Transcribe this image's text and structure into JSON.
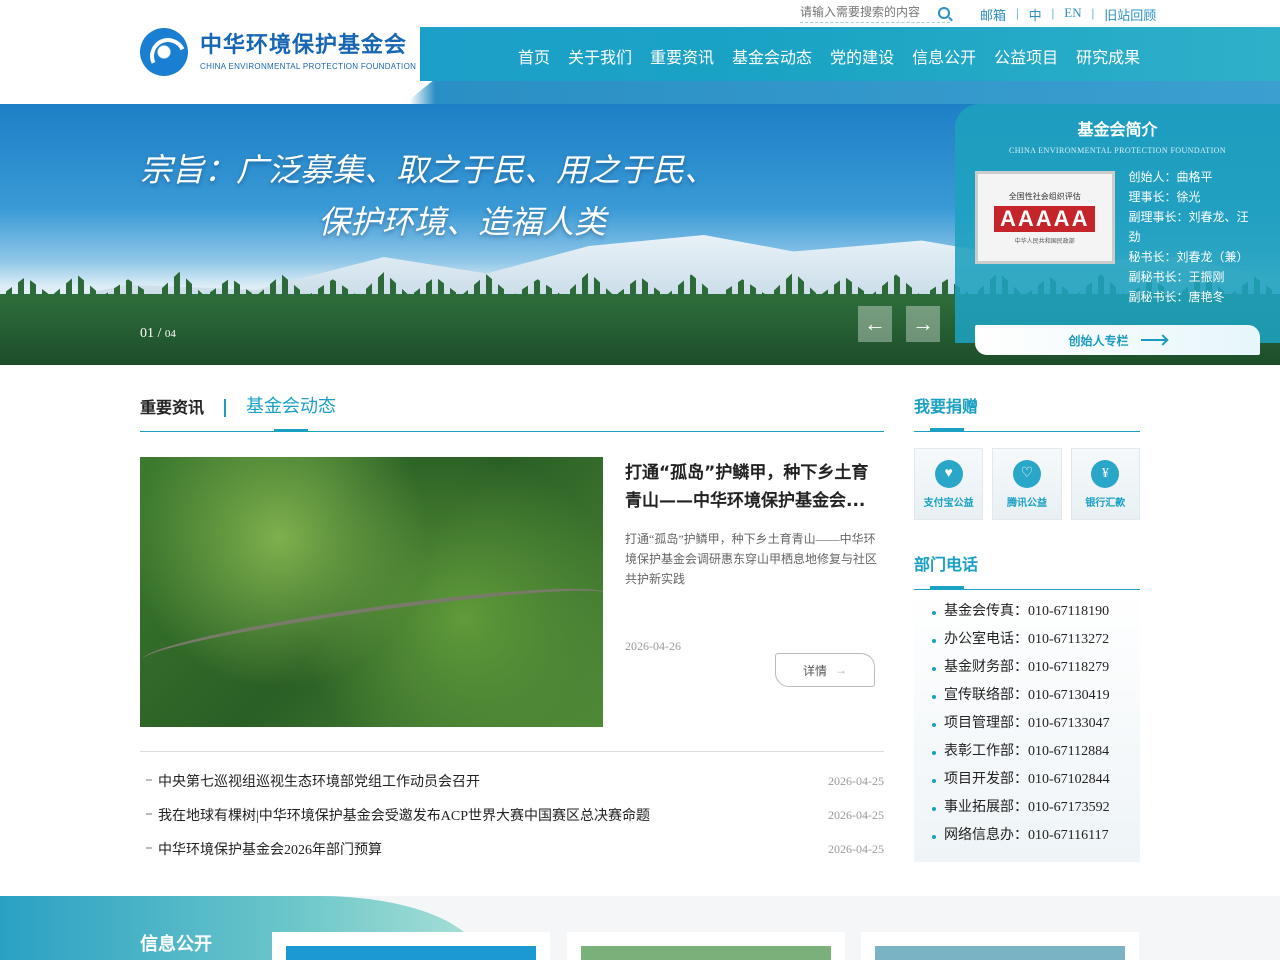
{
  "header": {
    "logo_cn": "中华环境保护基金会",
    "logo_en": "CHINA ENVIRONMENTAL PROTECTION FOUNDATION",
    "search_placeholder": "请输入需要搜索的内容",
    "top_links": [
      "邮箱",
      "中",
      "EN",
      "旧站回顾"
    ],
    "nav": [
      "首页",
      "关于我们",
      "重要资讯",
      "基金会动态",
      "党的建设",
      "信息公开",
      "公益项目",
      "研究成果"
    ]
  },
  "banner": {
    "slogan_line1": "宗旨：广泛募集、取之于民、用之于民、",
    "slogan_line2": "保护环境、造福人类",
    "slide_current": "01",
    "slide_total": "04",
    "prev": "←",
    "next": "→"
  },
  "intro": {
    "title": "基金会简介",
    "subtitle": "CHINA ENVIRONMENTAL PROTECTION FOUNDATION",
    "plaque_top": "全国性社会组织评估",
    "plaque_grade": "AAAAA",
    "plaque_bottom": "中华人民共和国民政部",
    "staff": [
      "创始人：曲格平",
      "理事长：徐光",
      "副理事长：刘春龙、汪劲",
      "秘书长：刘春龙（兼）",
      "副秘书长：王振刚",
      "副秘书长：唐艳冬"
    ],
    "founder_button": "创始人专栏"
  },
  "news": {
    "tab_active": "重要资讯",
    "tab_other": "基金会动态",
    "feature": {
      "title": "打通“孤岛”护鳞甲，种下乡土育青山——中华环境保护基金会...",
      "desc": "打通“孤岛”护鳞甲，种下乡土育青山——中华环境保护基金会调研惠东穿山甲栖息地修复与社区共护新实践",
      "date": "2026-04-26",
      "detail": "详情"
    },
    "list": [
      {
        "title": "中央第七巡视组巡视生态环境部党组工作动员会召开",
        "date": "2026-04-25"
      },
      {
        "title": "我在地球有棵树|中华环境保护基金会受邀发布ACP世界大赛中国赛区总决赛命题",
        "date": "2026-04-25"
      },
      {
        "title": "中华环境保护基金会2026年部门预算",
        "date": "2026-04-25"
      }
    ]
  },
  "side": {
    "donate_title": "我要捐赠",
    "donate": [
      {
        "label": "支付宝公益",
        "icon": "♥"
      },
      {
        "label": "腾讯公益",
        "icon": "♡"
      },
      {
        "label": "银行汇款",
        "icon": "¥"
      }
    ],
    "dept_title": "部门电话",
    "phones": [
      "基金会传真：010-67118190",
      "办公室电话：010-67113272",
      "基金财务部：010-67118279",
      "宣传联络部：010-67130419",
      "项目管理部：010-67133047",
      "表彰工作部：010-67112884",
      "项目开发部：010-67102844",
      "事业拓展部：010-67173592",
      "网络信息办：010-67116117"
    ]
  },
  "bottom": {
    "title": "信息公开"
  }
}
